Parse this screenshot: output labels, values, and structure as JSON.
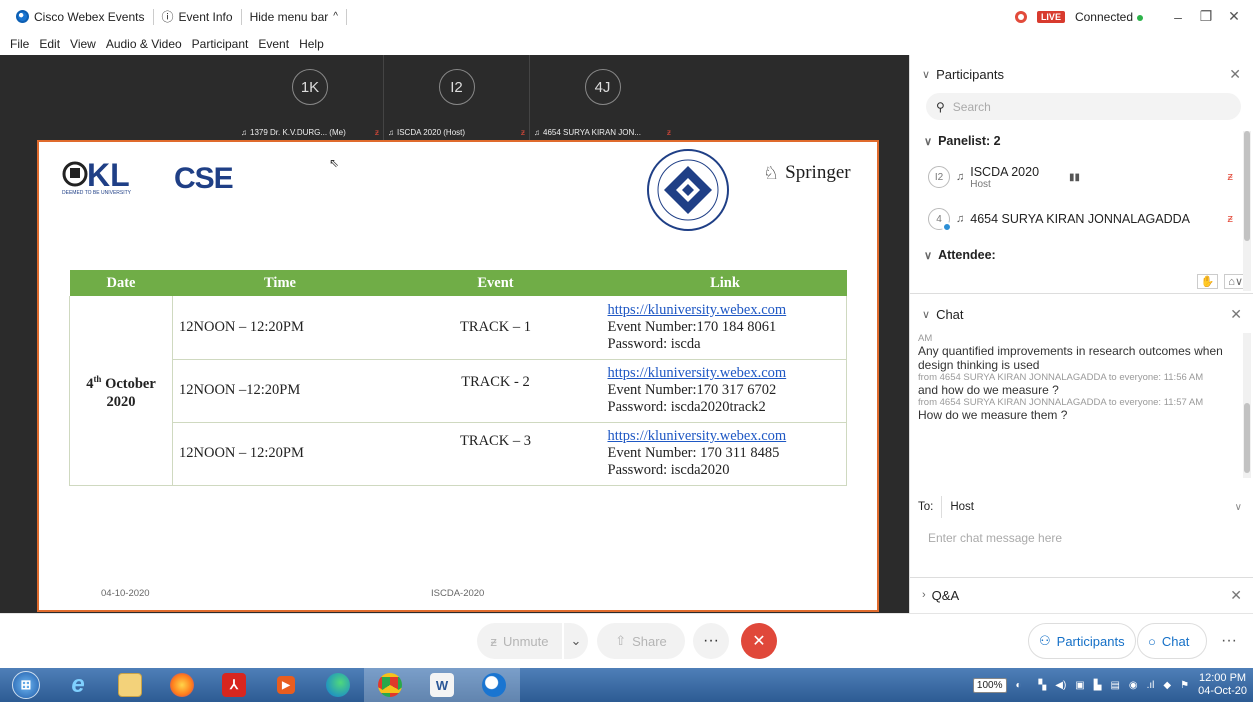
{
  "titlebar": {
    "app_name": "Cisco Webex Events",
    "event_info": "Event Info",
    "hide_menu": "Hide menu bar",
    "live": "LIVE",
    "status": "Connected"
  },
  "menu": [
    "File",
    "Edit",
    "View",
    "Audio & Video",
    "Participant",
    "Event",
    "Help"
  ],
  "thumbnails": [
    {
      "initials": "1K",
      "label": "1379 Dr. K.V.DURG... (Me)"
    },
    {
      "initials": "I2",
      "label": "ISCDA 2020 (Host)"
    },
    {
      "initials": "4J",
      "label": "4654 SURYA KIRAN JON..."
    }
  ],
  "slide": {
    "logo_cse": "CSE",
    "logo_springer": "Springer",
    "table_headers": [
      "Date",
      "Time",
      "Event",
      "Link"
    ],
    "date_day": "4",
    "date_sup": "th",
    "date_month": "October",
    "date_year": "2020",
    "rows": [
      {
        "time": "12NOON – 12:20PM",
        "event": "TRACK – 1",
        "link": "https://kluniversity.webex.com",
        "number": "Event Number:170 184 8061",
        "password": "Password: iscda"
      },
      {
        "time": "12NOON –12:20PM",
        "event": "TRACK - 2",
        "link": "https://kluniversity.webex.com",
        "number": "Event Number:170 317 6702",
        "password": "Password: iscda2020track2"
      },
      {
        "time": "12NOON – 12:20PM",
        "event": "TRACK – 3",
        "link": "https://kluniversity.webex.com",
        "number": "Event Number: 170 311 8485",
        "password": "Password: iscda2020"
      }
    ],
    "footer_date": "04-10-2020",
    "footer_conf": "ISCDA-2020"
  },
  "participants": {
    "title": "Participants",
    "search_placeholder": "Search",
    "panelist_label": "Panelist: 2",
    "panelists": [
      {
        "initials": "I2",
        "name": "ISCDA 2020",
        "role": "Host"
      },
      {
        "initials": "4J",
        "name": "4654 SURYA KIRAN JONNALAGADDA",
        "role": ""
      }
    ],
    "attendee_label": "Attendee:"
  },
  "chat": {
    "title": "Chat",
    "messages": [
      {
        "meta": "AM",
        "text": "Any quantified improvements in research outcomes when design thinking is used"
      },
      {
        "meta": "from 4654 SURYA KIRAN JONNALAGADDA to everyone:  11:56 AM",
        "text": "and how do we measure ?"
      },
      {
        "meta": "from 4654 SURYA KIRAN JONNALAGADDA to everyone:  11:57 AM",
        "text": "How do we measure them ?"
      }
    ],
    "to_label": "To:",
    "to_value": "Host",
    "input_placeholder": "Enter chat message here"
  },
  "qa": {
    "title": "Q&A"
  },
  "controls": {
    "unmute": "Unmute",
    "share": "Share",
    "more": "···",
    "participants_btn": "Participants",
    "chat_btn": "Chat"
  },
  "taskbar": {
    "battery": "100%",
    "time": "12:00 PM",
    "date": "04-Oct-20"
  },
  "colors": {
    "table_header": "#70ad47",
    "slide_border": "#e06b2d",
    "end_button": "#e0483a",
    "link": "#1f58c4",
    "accent": "#1570c7"
  }
}
